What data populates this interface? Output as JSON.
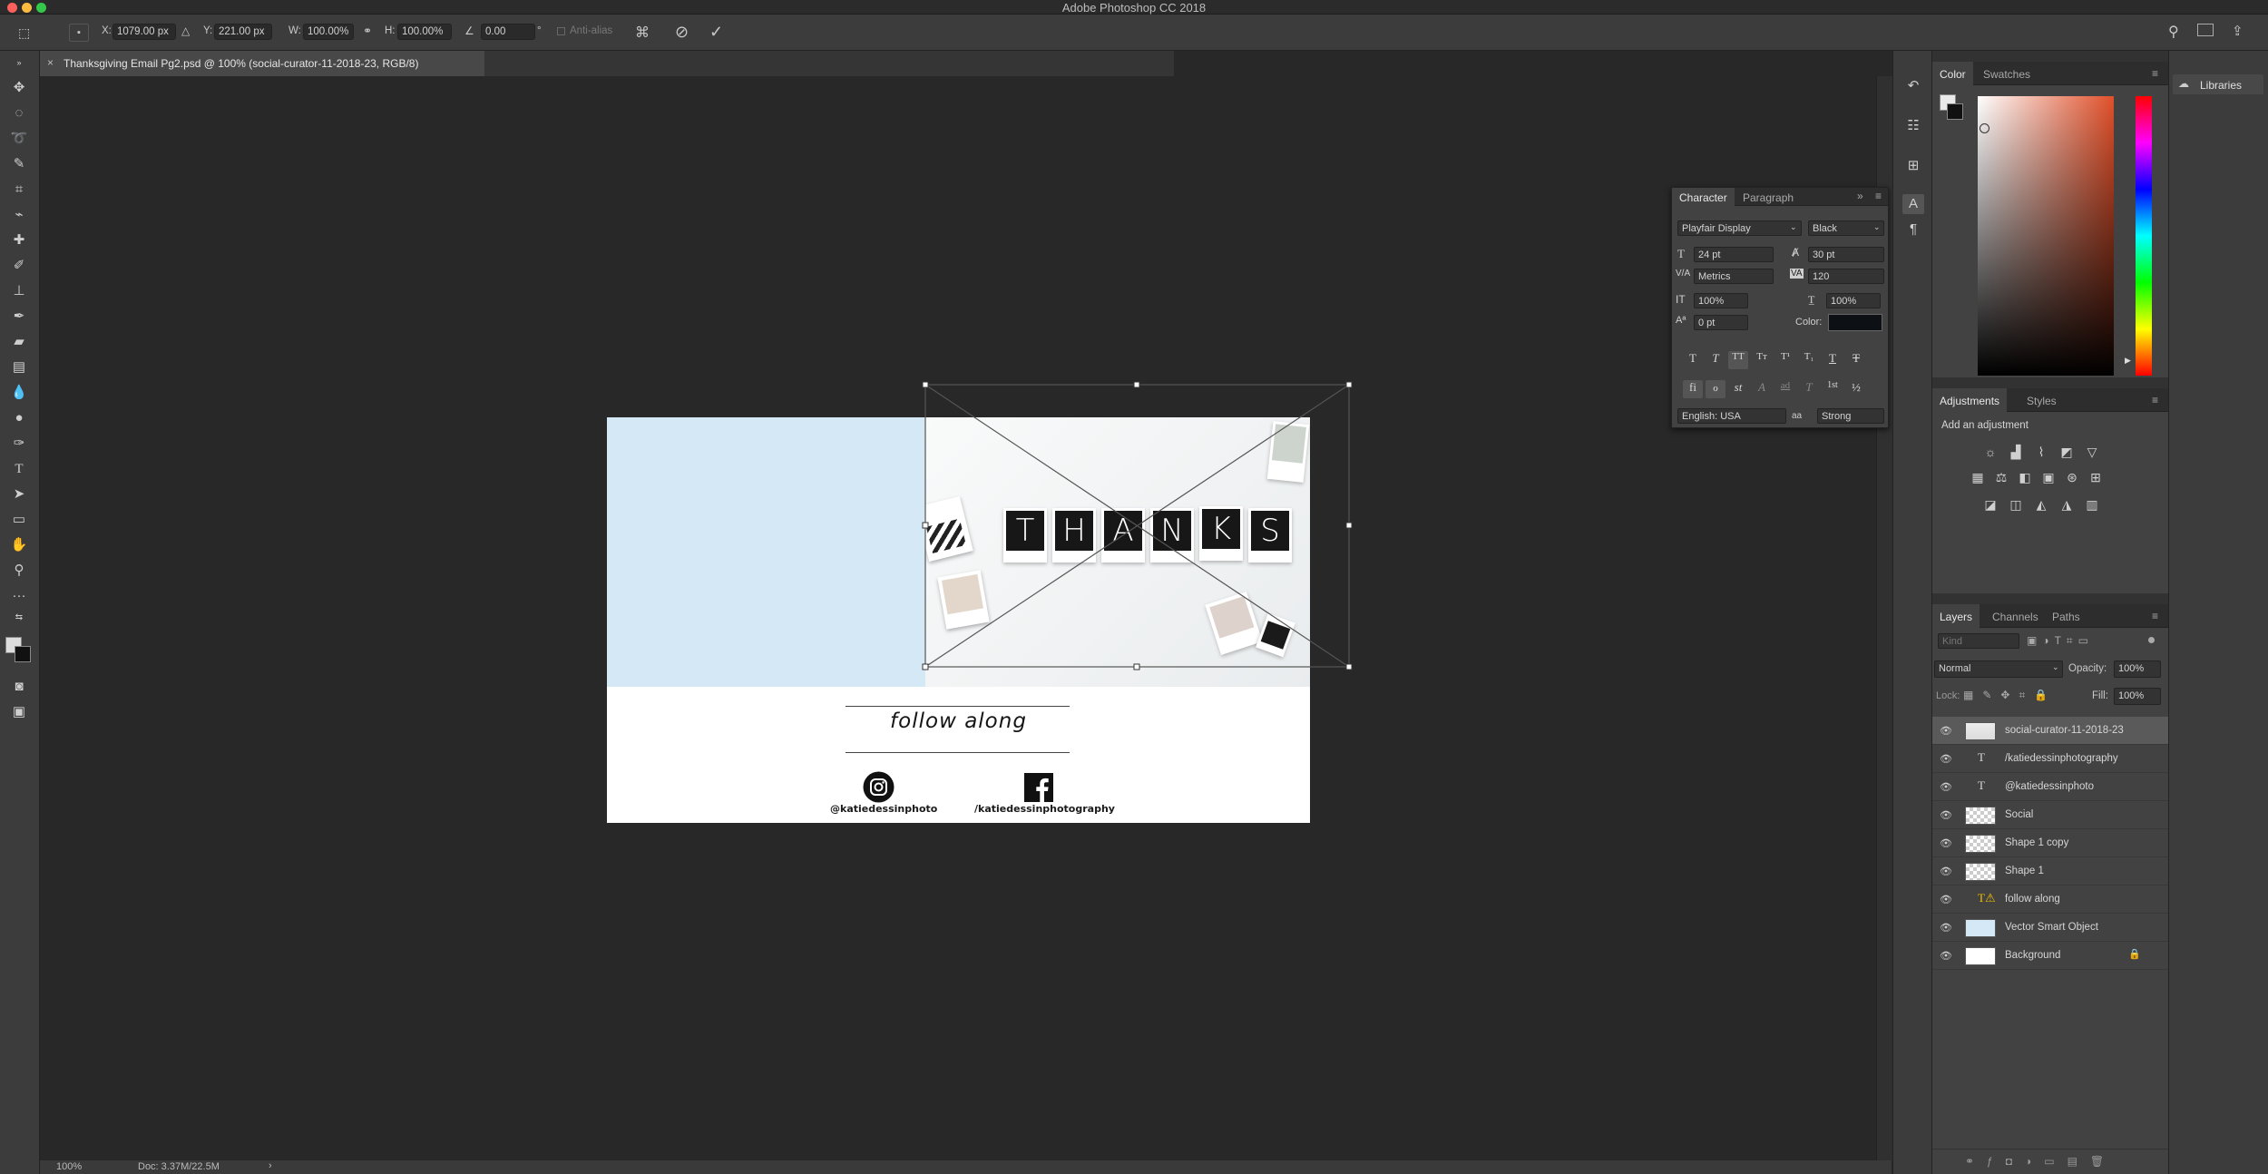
{
  "app": {
    "title": "Adobe Photoshop CC 2018"
  },
  "options_bar": {
    "x_label": "X:",
    "x_value": "1079.00 px",
    "y_label": "Y:",
    "y_value": "221.00 px",
    "w_label": "W:",
    "w_value": "100.00%",
    "h_label": "H:",
    "h_value": "100.00%",
    "angle_value": "0.00",
    "angle_unit": "°",
    "antialias_label": "Anti-alias"
  },
  "document": {
    "tab_title": "Thanksgiving Email Pg2.psd @ 100% (social-curator-11-2018-23, RGB/8)",
    "zoom": "100%",
    "doc_info": "Doc: 3.37M/22.5M"
  },
  "artwork": {
    "thanks_letters": [
      "T",
      "H",
      "A",
      "N",
      "K",
      "S"
    ],
    "follow_text": "follow along",
    "instagram_handle": "@katiedessinphoto",
    "facebook_handle": "/katiedessinphotography",
    "blue_color": "#d4e8f6"
  },
  "character_panel": {
    "tabs": [
      "Character",
      "Paragraph"
    ],
    "font_family": "Playfair Display",
    "font_style": "Black",
    "font_size": "24 pt",
    "leading": "30 pt",
    "kerning": "Metrics",
    "tracking": "120",
    "vertical_scale": "100%",
    "horizontal_scale": "100%",
    "baseline_shift": "0 pt",
    "color_label": "Color:",
    "language": "English: USA",
    "antialias": "Strong",
    "antialias_icon_text": "aa",
    "style_buttons": [
      "T",
      "T",
      "TT",
      "Tт",
      "T¹",
      "T₁",
      "T",
      "T"
    ],
    "opentype_buttons": [
      "fi",
      "ℴ",
      "st",
      "A",
      "ad",
      "T",
      "1st",
      "½"
    ]
  },
  "color_panel": {
    "tabs": [
      "Color",
      "Swatches"
    ]
  },
  "adjustments_panel": {
    "tabs": [
      "Adjustments",
      "Styles"
    ],
    "add_label": "Add an adjustment"
  },
  "layers_panel": {
    "tabs": [
      "Layers",
      "Channels",
      "Paths"
    ],
    "kind_placeholder": "Kind",
    "blend_mode": "Normal",
    "opacity_label": "Opacity:",
    "opacity_value": "100%",
    "lock_label": "Lock:",
    "fill_label": "Fill:",
    "fill_value": "100%",
    "layers": [
      {
        "name": "social-curator-11-2018-23",
        "kind": "smart",
        "selected": true
      },
      {
        "name": "/katiedessinphotography",
        "kind": "text"
      },
      {
        "name": "@katiedessinphoto",
        "kind": "text"
      },
      {
        "name": "Social",
        "kind": "smart"
      },
      {
        "name": "Shape 1 copy",
        "kind": "shape"
      },
      {
        "name": "Shape 1",
        "kind": "shape"
      },
      {
        "name": "follow along",
        "kind": "text-warning"
      },
      {
        "name": "Vector Smart Object",
        "kind": "smart"
      },
      {
        "name": "Background",
        "kind": "background",
        "locked": true
      }
    ]
  },
  "libraries": {
    "label": "Libraries"
  }
}
